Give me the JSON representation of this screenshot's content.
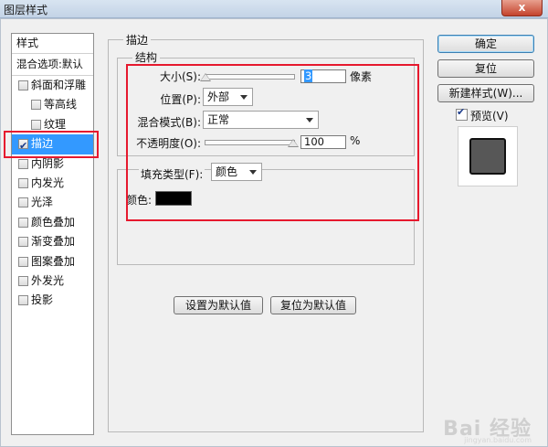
{
  "window": {
    "title": "图层样式",
    "close_label": "x"
  },
  "styles": {
    "header": "样式",
    "blend_options": "混合选项:默认",
    "items": [
      {
        "label": "斜面和浮雕",
        "checked": false,
        "level": 0,
        "selected": false
      },
      {
        "label": "等高线",
        "checked": false,
        "level": 1,
        "selected": false
      },
      {
        "label": "纹理",
        "checked": false,
        "level": 1,
        "selected": false
      },
      {
        "label": "描边",
        "checked": true,
        "level": 0,
        "selected": true
      },
      {
        "label": "内阴影",
        "checked": false,
        "level": 0,
        "selected": false
      },
      {
        "label": "内发光",
        "checked": false,
        "level": 0,
        "selected": false
      },
      {
        "label": "光泽",
        "checked": false,
        "level": 0,
        "selected": false
      },
      {
        "label": "颜色叠加",
        "checked": false,
        "level": 0,
        "selected": false
      },
      {
        "label": "渐变叠加",
        "checked": false,
        "level": 0,
        "selected": false
      },
      {
        "label": "图案叠加",
        "checked": false,
        "level": 0,
        "selected": false
      },
      {
        "label": "外发光",
        "checked": false,
        "level": 0,
        "selected": false
      },
      {
        "label": "投影",
        "checked": false,
        "level": 0,
        "selected": false
      }
    ]
  },
  "stroke": {
    "group_title": "描边",
    "structure_title": "结构",
    "size": {
      "label": "大小(S):",
      "value": "3",
      "unit": "像素",
      "slider_fraction": 0.01
    },
    "position": {
      "label": "位置(P):",
      "value": "外部"
    },
    "blend_mode": {
      "label": "混合模式(B):",
      "value": "正常"
    },
    "opacity": {
      "label": "不透明度(O):",
      "value": "100",
      "unit": "%",
      "slider_fraction": 1.0
    },
    "fill_type": {
      "label": "填充类型(F):",
      "value": "颜色"
    },
    "color": {
      "label": "颜色:",
      "value": "#000000"
    }
  },
  "defaults": {
    "make_default": "设置为默认值",
    "reset_default": "复位为默认值"
  },
  "buttons": {
    "ok": "确定",
    "reset": "复位",
    "new_style": "新建样式(W)...",
    "preview": "预览(V)",
    "preview_checked": true
  },
  "watermark": {
    "text": "Bai 经验",
    "sub": "jingyan.baidu.com"
  },
  "colors": {
    "selection": "#3399ff",
    "highlight": "#e6192e"
  }
}
